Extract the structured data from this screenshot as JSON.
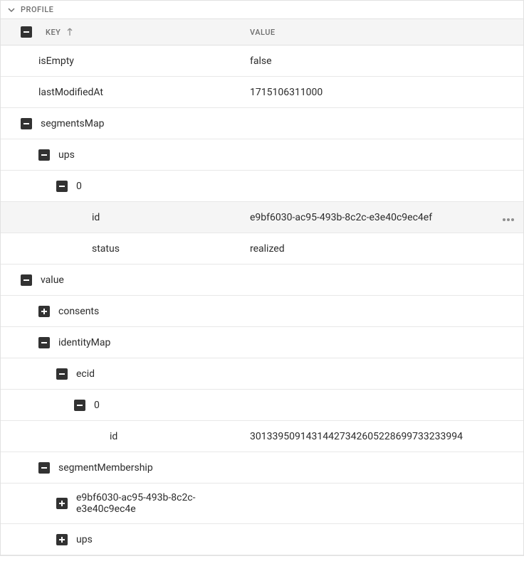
{
  "section": {
    "title": "PROFILE"
  },
  "headers": {
    "key": "KEY",
    "value": "VALUE"
  },
  "rows": {
    "isEmpty": {
      "key": "isEmpty",
      "value": "false"
    },
    "lastModifiedAt": {
      "key": "lastModifiedAt",
      "value": "1715106311000"
    },
    "segmentsMap": {
      "key": "segmentsMap"
    },
    "ups": {
      "key": "ups"
    },
    "upsZero": {
      "key": "0"
    },
    "upsId": {
      "key": "id",
      "value": "e9bf6030-ac95-493b-8c2c-e3e40c9ec4ef"
    },
    "upsStatus": {
      "key": "status",
      "value": "realized"
    },
    "value": {
      "key": "value"
    },
    "consents": {
      "key": "consents"
    },
    "identityMap": {
      "key": "identityMap"
    },
    "ecid": {
      "key": "ecid"
    },
    "ecidZero": {
      "key": "0"
    },
    "ecidId": {
      "key": "id",
      "value": "30133950914314427342605228699733233994"
    },
    "segmentMembership": {
      "key": "segmentMembership"
    },
    "segGuid": {
      "key": "e9bf6030-ac95-493b-8c2c-e3e40c9ec4e"
    },
    "segUps": {
      "key": "ups"
    }
  }
}
